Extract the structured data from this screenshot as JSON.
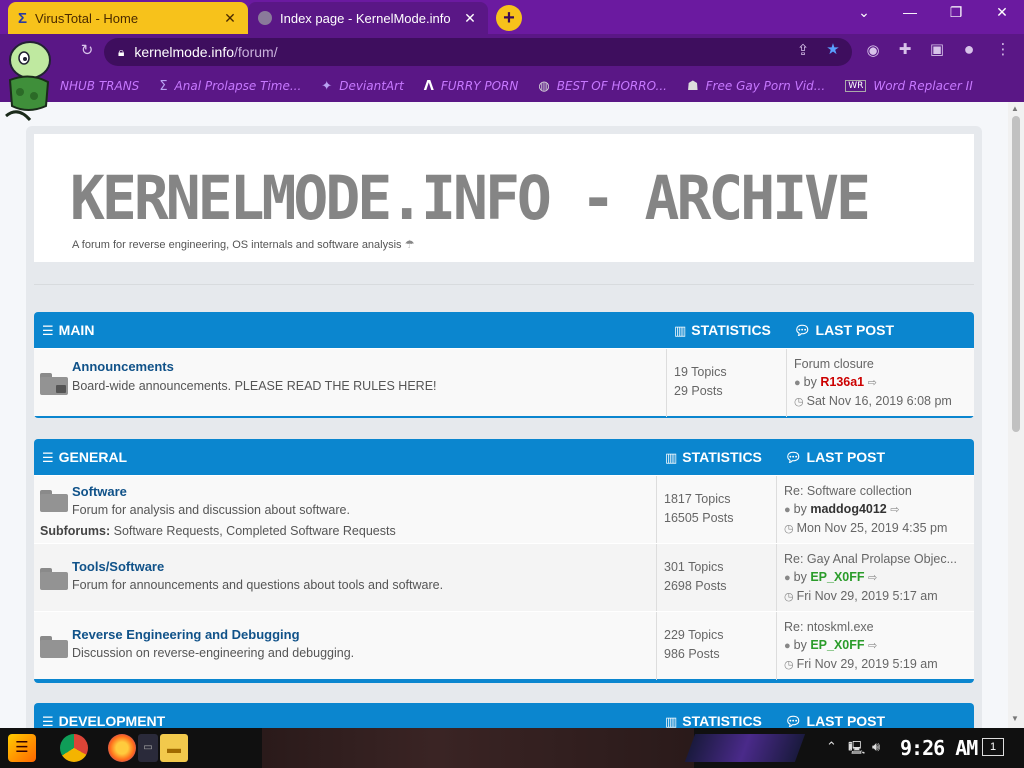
{
  "browser": {
    "tabs": [
      {
        "title": "VirusTotal - Home",
        "icon": "virustotal-icon"
      },
      {
        "title": "Index page - KernelMode.info",
        "icon": "kernelmode-icon"
      }
    ],
    "url_host": "kernelmode.info",
    "url_path": "/forum/",
    "bookmarks": [
      {
        "label": "NHUB TRANS",
        "icon": "bookmark-icon"
      },
      {
        "label": "Anal Prolapse Time...",
        "icon": "bookmark-icon"
      },
      {
        "label": "DeviantArt",
        "icon": "deviantart-icon"
      },
      {
        "label": "FURRY PORN",
        "icon": "bookmark-icon"
      },
      {
        "label": "BEST OF HORRO...",
        "icon": "globe-icon"
      },
      {
        "label": "Free Gay Porn Vid...",
        "icon": "bookmark-icon"
      },
      {
        "label": "Word Replacer II",
        "icon": "wr-icon"
      }
    ],
    "colors": {
      "frame": "#5a1786",
      "tabstrip": "#6b1aa0",
      "active_tab": "#f7c21b",
      "bookmark_text": "#c778ff"
    }
  },
  "site": {
    "title": "KERNELMODE.INFO - ARCHIVE",
    "description": "A forum for reverse engineering, OS internals and software analysis"
  },
  "headers": {
    "statistics": "STATISTICS",
    "last_post": "LAST POST"
  },
  "categories": [
    {
      "name": "MAIN",
      "forums": [
        {
          "name": "Announcements",
          "desc": "Board-wide announcements. PLEASE READ THE RULES HERE!",
          "topics": "19 Topics",
          "posts": "29 Posts",
          "last_title": "Forum closure",
          "by": "by",
          "last_user": "R136a1",
          "last_date": "Sat Nov 16, 2019 6:08 pm"
        }
      ]
    },
    {
      "name": "GENERAL",
      "forums": [
        {
          "name": "Software",
          "desc": "Forum for analysis and discussion about software.",
          "subforums_label": "Subforums:",
          "subforums": "Software Requests, Completed Software Requests",
          "topics": "1817 Topics",
          "posts": "16505 Posts",
          "last_title": "Re: Software collection",
          "by": "by",
          "last_user": "maddog4012",
          "last_date": "Mon Nov 25, 2019 4:35 pm"
        },
        {
          "name": "Tools/Software",
          "desc": "Forum for announcements and questions about tools and software.",
          "topics": "301 Topics",
          "posts": "2698 Posts",
          "last_title": "Re: Gay Anal Prolapse Objec...",
          "by": "by",
          "last_user": "EP_X0FF",
          "last_date": "Fri Nov 29, 2019 5:17 am"
        },
        {
          "name": "Reverse Engineering and Debugging",
          "desc": "Discussion on reverse-engineering and debugging.",
          "topics": "229 Topics",
          "posts": "986 Posts",
          "last_title": "Re: ntoskml.exe",
          "by": "by",
          "last_user": "EP_X0FF",
          "last_date": "Fri Nov 29, 2019 5:19 am"
        }
      ]
    },
    {
      "name": "DEVELOPMENT",
      "forums": []
    }
  ],
  "taskbar": {
    "clock": "9:26 AM",
    "notification_count": "1"
  }
}
